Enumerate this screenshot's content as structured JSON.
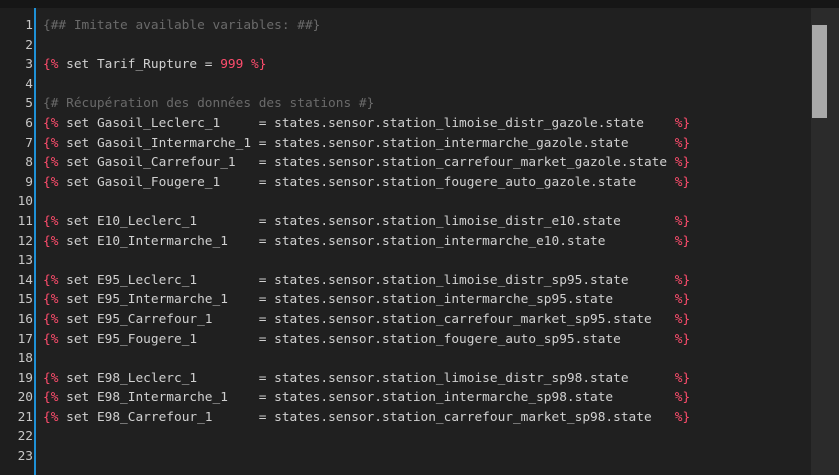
{
  "editor": {
    "lines": [
      {
        "n": "1",
        "parts": [
          {
            "c": "comment",
            "t": "{## Imitate available variables: ##}"
          }
        ]
      },
      {
        "n": "2",
        "parts": []
      },
      {
        "n": "3",
        "parts": [
          {
            "c": "tag",
            "t": "{%"
          },
          {
            "c": "kw",
            "t": " set Tarif_Rupture = "
          },
          {
            "c": "num",
            "t": "999"
          },
          {
            "c": "tag",
            "t": " %}"
          }
        ]
      },
      {
        "n": "4",
        "parts": []
      },
      {
        "n": "5",
        "parts": [
          {
            "c": "comment",
            "t": "{# Récupération des données des stations #}"
          }
        ]
      },
      {
        "n": "6",
        "parts": [
          {
            "c": "tag",
            "t": "{%"
          },
          {
            "c": "kw",
            "t": " set Gasoil_Leclerc_1     = states.sensor.station_limoise_distr_gazole.state    "
          },
          {
            "c": "tag",
            "t": "%}"
          }
        ]
      },
      {
        "n": "7",
        "parts": [
          {
            "c": "tag",
            "t": "{%"
          },
          {
            "c": "kw",
            "t": " set Gasoil_Intermarche_1 = states.sensor.station_intermarche_gazole.state      "
          },
          {
            "c": "tag",
            "t": "%}"
          }
        ]
      },
      {
        "n": "8",
        "parts": [
          {
            "c": "tag",
            "t": "{%"
          },
          {
            "c": "kw",
            "t": " set Gasoil_Carrefour_1   = states.sensor.station_carrefour_market_gazole.state "
          },
          {
            "c": "tag",
            "t": "%}"
          }
        ]
      },
      {
        "n": "9",
        "parts": [
          {
            "c": "tag",
            "t": "{%"
          },
          {
            "c": "kw",
            "t": " set Gasoil_Fougere_1     = states.sensor.station_fougere_auto_gazole.state     "
          },
          {
            "c": "tag",
            "t": "%}"
          }
        ]
      },
      {
        "n": "10",
        "parts": []
      },
      {
        "n": "11",
        "parts": [
          {
            "c": "tag",
            "t": "{%"
          },
          {
            "c": "kw",
            "t": " set E10_Leclerc_1        = states.sensor.station_limoise_distr_e10.state       "
          },
          {
            "c": "tag",
            "t": "%}"
          }
        ]
      },
      {
        "n": "12",
        "parts": [
          {
            "c": "tag",
            "t": "{%"
          },
          {
            "c": "kw",
            "t": " set E10_Intermarche_1    = states.sensor.station_intermarche_e10.state         "
          },
          {
            "c": "tag",
            "t": "%}"
          }
        ]
      },
      {
        "n": "13",
        "parts": []
      },
      {
        "n": "14",
        "parts": [
          {
            "c": "tag",
            "t": "{%"
          },
          {
            "c": "kw",
            "t": " set E95_Leclerc_1        = states.sensor.station_limoise_distr_sp95.state      "
          },
          {
            "c": "tag",
            "t": "%}"
          }
        ]
      },
      {
        "n": "15",
        "parts": [
          {
            "c": "tag",
            "t": "{%"
          },
          {
            "c": "kw",
            "t": " set E95_Intermarche_1    = states.sensor.station_intermarche_sp95.state        "
          },
          {
            "c": "tag",
            "t": "%}"
          }
        ]
      },
      {
        "n": "16",
        "parts": [
          {
            "c": "tag",
            "t": "{%"
          },
          {
            "c": "kw",
            "t": " set E95_Carrefour_1      = states.sensor.station_carrefour_market_sp95.state   "
          },
          {
            "c": "tag",
            "t": "%}"
          }
        ]
      },
      {
        "n": "17",
        "parts": [
          {
            "c": "tag",
            "t": "{%"
          },
          {
            "c": "kw",
            "t": " set E95_Fougere_1        = states.sensor.station_fougere_auto_sp95.state       "
          },
          {
            "c": "tag",
            "t": "%}"
          }
        ]
      },
      {
        "n": "18",
        "parts": []
      },
      {
        "n": "19",
        "parts": [
          {
            "c": "tag",
            "t": "{%"
          },
          {
            "c": "kw",
            "t": " set E98_Leclerc_1        = states.sensor.station_limoise_distr_sp98.state      "
          },
          {
            "c": "tag",
            "t": "%}"
          }
        ]
      },
      {
        "n": "20",
        "parts": [
          {
            "c": "tag",
            "t": "{%"
          },
          {
            "c": "kw",
            "t": " set E98_Intermarche_1    = states.sensor.station_intermarche_sp98.state        "
          },
          {
            "c": "tag",
            "t": "%}"
          }
        ]
      },
      {
        "n": "21",
        "parts": [
          {
            "c": "tag",
            "t": "{%"
          },
          {
            "c": "kw",
            "t": " set E98_Carrefour_1      = states.sensor.station_carrefour_market_sp98.state   "
          },
          {
            "c": "tag",
            "t": "%}"
          }
        ]
      },
      {
        "n": "22",
        "parts": []
      },
      {
        "n": "23",
        "parts": []
      }
    ]
  },
  "colors": {
    "background": "#1e1e1e",
    "gutter_border": "#1e90d6",
    "tag": "#ff4d6d",
    "text": "#d0d0d0",
    "comment": "#6a6a6a",
    "scrollbar_thumb": "#a9a9a9"
  }
}
